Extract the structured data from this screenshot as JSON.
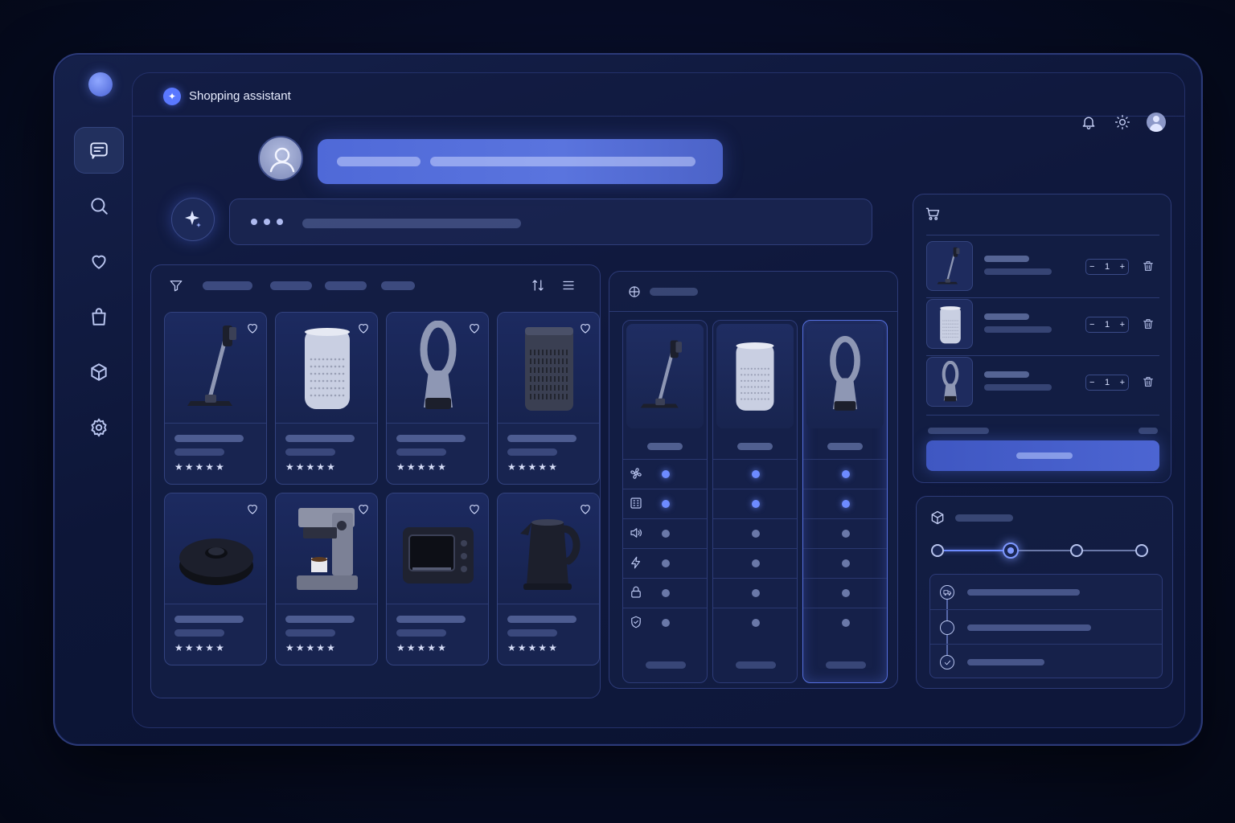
{
  "app": {
    "title": "Shopping assistant"
  },
  "sidebar": {
    "items": [
      {
        "id": "chat",
        "icon": "chat-icon",
        "active": true
      },
      {
        "id": "search",
        "icon": "search-icon",
        "active": false
      },
      {
        "id": "favorites",
        "icon": "heart-icon",
        "active": false
      },
      {
        "id": "bag",
        "icon": "shopping-bag-icon",
        "active": false
      },
      {
        "id": "orders",
        "icon": "package-icon",
        "active": false
      },
      {
        "id": "settings",
        "icon": "gear-icon",
        "active": false
      }
    ]
  },
  "header": {
    "icons": [
      "bell-icon",
      "sun-icon",
      "avatar-icon"
    ]
  },
  "products": [
    {
      "id": "stick-vacuum",
      "icon": "stick-vacuum",
      "rating": 4.5
    },
    {
      "id": "air-purifier",
      "icon": "air-purifier",
      "rating": 4.5
    },
    {
      "id": "bladeless-fan",
      "icon": "bladeless-fan",
      "rating": 5
    },
    {
      "id": "tower-purifier",
      "icon": "tower-purifier",
      "rating": 4.5
    },
    {
      "id": "robot-vacuum",
      "icon": "robot-vacuum",
      "rating": 4.5
    },
    {
      "id": "espresso-machine",
      "icon": "espresso-machine",
      "rating": 4.5
    },
    {
      "id": "toaster-oven",
      "icon": "toaster-oven",
      "rating": 4.5
    },
    {
      "id": "electric-kettle",
      "icon": "electric-kettle",
      "rating": 4.5
    }
  ],
  "comparison": {
    "products": [
      "stick-vacuum",
      "air-purifier",
      "bladeless-fan"
    ],
    "selected_index": 2,
    "features": [
      {
        "icon": "fan-icon",
        "values": [
          true,
          true,
          true
        ]
      },
      {
        "icon": "filter-icon",
        "values": [
          true,
          true,
          true
        ]
      },
      {
        "icon": "speaker-icon",
        "values": [
          false,
          false,
          false
        ]
      },
      {
        "icon": "bolt-icon",
        "values": [
          false,
          false,
          false
        ]
      },
      {
        "icon": "lock-icon",
        "values": [
          false,
          false,
          false
        ]
      },
      {
        "icon": "shield-icon",
        "values": [
          false,
          false,
          false
        ]
      }
    ]
  },
  "cart": {
    "items": [
      {
        "product": "stick-vacuum",
        "quantity": "1"
      },
      {
        "product": "air-purifier",
        "quantity": "1"
      },
      {
        "product": "bladeless-fan",
        "quantity": "1"
      }
    ],
    "minus": "−",
    "plus": "+"
  },
  "tracking": {
    "steps": 4,
    "current_step": 2,
    "events": [
      {
        "icon": "truck-icon"
      },
      {
        "icon": "dot-icon"
      },
      {
        "icon": "check-icon"
      }
    ]
  },
  "colors": {
    "accent": "#5a78ff",
    "background": "#070d26",
    "panel": "#14204a"
  }
}
